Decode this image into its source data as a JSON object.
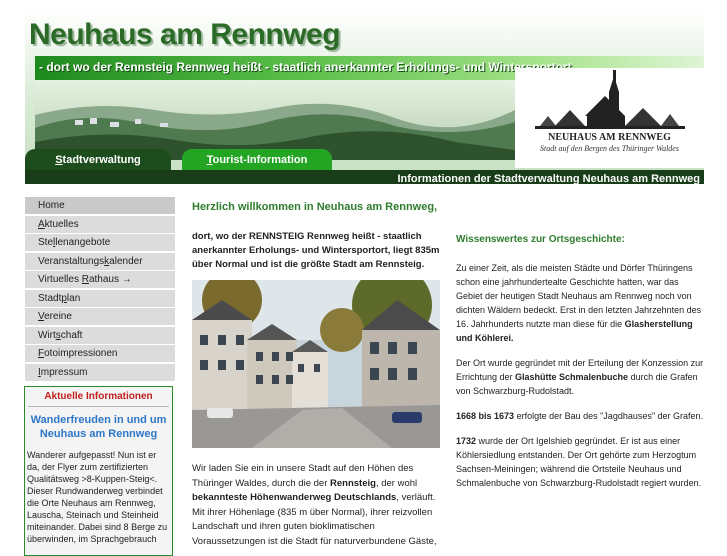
{
  "header": {
    "title": "Neuhaus am Rennweg",
    "subtitle": "- dort wo der Rennsteig Rennweg heißt - staatlich anerkannter Erholungs- und Wintersportort",
    "logo_name": "NEUHAUS AM RENNWEG",
    "logo_tagline": "Stadt auf den Bergen des Thüringer Waldes",
    "tabs": [
      {
        "underline": "S",
        "rest": "tadtverwaltung"
      },
      {
        "underline": "T",
        "rest": "ourist-Information"
      }
    ],
    "band_text": "Informationen der Stadtverwaltung Neuhaus am Rennweg"
  },
  "sidebar": {
    "items": [
      {
        "pre": "",
        "u": "",
        "post": "Home"
      },
      {
        "pre": "",
        "u": "A",
        "post": "ktuelles"
      },
      {
        "pre": "Ste",
        "u": "l",
        "post": "lenangebote"
      },
      {
        "pre": "Veranstaltungs",
        "u": "k",
        "post": "alender"
      },
      {
        "pre": "Virtuelles ",
        "u": "R",
        "post": "athaus →"
      },
      {
        "pre": "Stadt",
        "u": "p",
        "post": "lan"
      },
      {
        "pre": "",
        "u": "V",
        "post": "ereine"
      },
      {
        "pre": "Wirt",
        "u": "s",
        "post": "chaft"
      },
      {
        "pre": "",
        "u": "F",
        "post": "otoimpressionen"
      },
      {
        "pre": "",
        "u": "I",
        "post": "mpressum"
      }
    ],
    "info": {
      "title": "Aktuelle Informationen",
      "headline": "Wanderfreuden in und um Neuhaus am Rennweg",
      "text": "Wanderer aufgepasst! Nun ist er da, der Flyer zum zertifizierten Qualitätsweg >8-Kuppen-Steig<. Dieser Rundwanderweg verbindet die Orte Neuhaus am Rennweg, Lauscha, Steinach und Steinheid miteinander. Dabei sind 8 Berge zu überwinden, im Sprachgebrauch"
    }
  },
  "main": {
    "welcome": "Herzlich willkommen in Neuhaus am Rennweg,",
    "intro": "dort, wo der RENNSTEIG Rennweg heißt - staatlich anerkannter Erholungs- und Wintersportort, liegt 835m über Normal und ist die größte Stadt am Rennsteig.",
    "invite": {
      "p1": "Wir laden Sie ein in unsere Stadt auf den Höhen des Thüringer Waldes, durch die der ",
      "b1": "Rennsteig",
      "p2": ", der wohl ",
      "b2": "bekannteste Höhenwanderweg Deutschlands",
      "p3": ", verläuft. Mit ihrer Höhenlage (835 m über Normal), ihrer reizvollen Landschaft und ihren guten bioklimatischen Voraussetzungen ist die Stadt für naturverbundene Gäste,"
    }
  },
  "facts": {
    "heading": "Wissenswertes zur Ortsgeschichte:",
    "p1": {
      "text": "Zu einer Zeit, als die meisten Städte und Dörfer Thüringens schon eine jahrhundertealte Geschichte hatten, war das Gebiet der heutigen Stadt Neuhaus am Rennweg noch von dichten Wäldern bedeckt. Erst in den letzten Jahrzehnten des 16. Jahrhunderts nutzte man diese für die ",
      "bold": "Glasherstellung und Köhlerei."
    },
    "p2": {
      "a": "Der Ort wurde gegründet mit der Erteilung der Konzession zur Errichtung der ",
      "b1": "Glashütte Schmalenbuche",
      "c": " durch die Grafen von Schwarzburg-Rudolstadt."
    },
    "p3": {
      "b1": "1668 bis 1673",
      "c": " erfolgte der Bau des \"Jagdhauses\" der Grafen."
    },
    "p4": {
      "b1": "1732",
      "c": " wurde der Ort Igelshieb gegründet. Er ist aus einer Köhlersiedlung entstanden. Der Ort gehörte zum Herzogtum Sachsen-Meiningen; während die Ortsteile Neuhaus und Schmalenbuche von Schwarzburg-Rudolstadt regiert wurden."
    }
  }
}
